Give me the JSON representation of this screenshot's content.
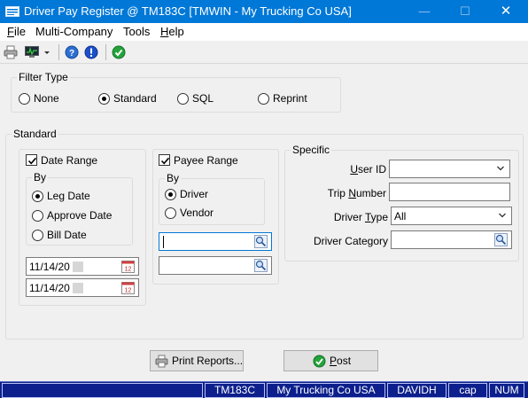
{
  "window": {
    "title": "Driver Pay Register @ TM183C [TMWIN - My Trucking Co USA]",
    "controls": {
      "minimize": "—",
      "maximize": "☐",
      "close": "✕"
    }
  },
  "menu": {
    "file": "File",
    "multi_company": "Multi-Company",
    "tools": "Tools",
    "help": "Help"
  },
  "toolbar": {
    "icons": [
      "printer-icon",
      "monitor-icon",
      "dropdown-arrow-icon",
      "help-icon",
      "info-icon",
      "ok-icon"
    ]
  },
  "filter_type": {
    "legend": "Filter Type",
    "options": [
      "None",
      "Standard",
      "SQL",
      "Reprint"
    ],
    "selected": "Standard"
  },
  "standard": {
    "legend": "Standard",
    "date_range": {
      "label": "Date Range",
      "checked": true,
      "by_legend": "By",
      "options": [
        "Leg Date",
        "Approve Date",
        "Bill Date"
      ],
      "selected": "Leg Date",
      "from_date": "11/14/20",
      "to_date": "11/14/20"
    },
    "payee_range": {
      "label": "Payee Range",
      "checked": true,
      "by_legend": "By",
      "options": [
        "Driver",
        "Vendor"
      ],
      "selected": "Driver",
      "from_value": "",
      "to_value": ""
    },
    "specific": {
      "legend": "Specific",
      "user_id": {
        "label": "User ID",
        "value": ""
      },
      "trip_number": {
        "label": "Trip Number",
        "value": ""
      },
      "driver_type": {
        "label": "Driver Type",
        "value": "All"
      },
      "driver_category": {
        "label": "Driver Category",
        "value": ""
      }
    }
  },
  "buttons": {
    "print_reports": "Print Reports...",
    "post": "Post"
  },
  "statusbar": {
    "server": "TM183C",
    "company": "My Trucking Co USA",
    "user": "DAVIDH",
    "caps": "cap",
    "num": "NUM"
  },
  "colors": {
    "title_bar": "#0078d7",
    "status_bar": "#0c1f8c",
    "accent": "#0078d7"
  }
}
